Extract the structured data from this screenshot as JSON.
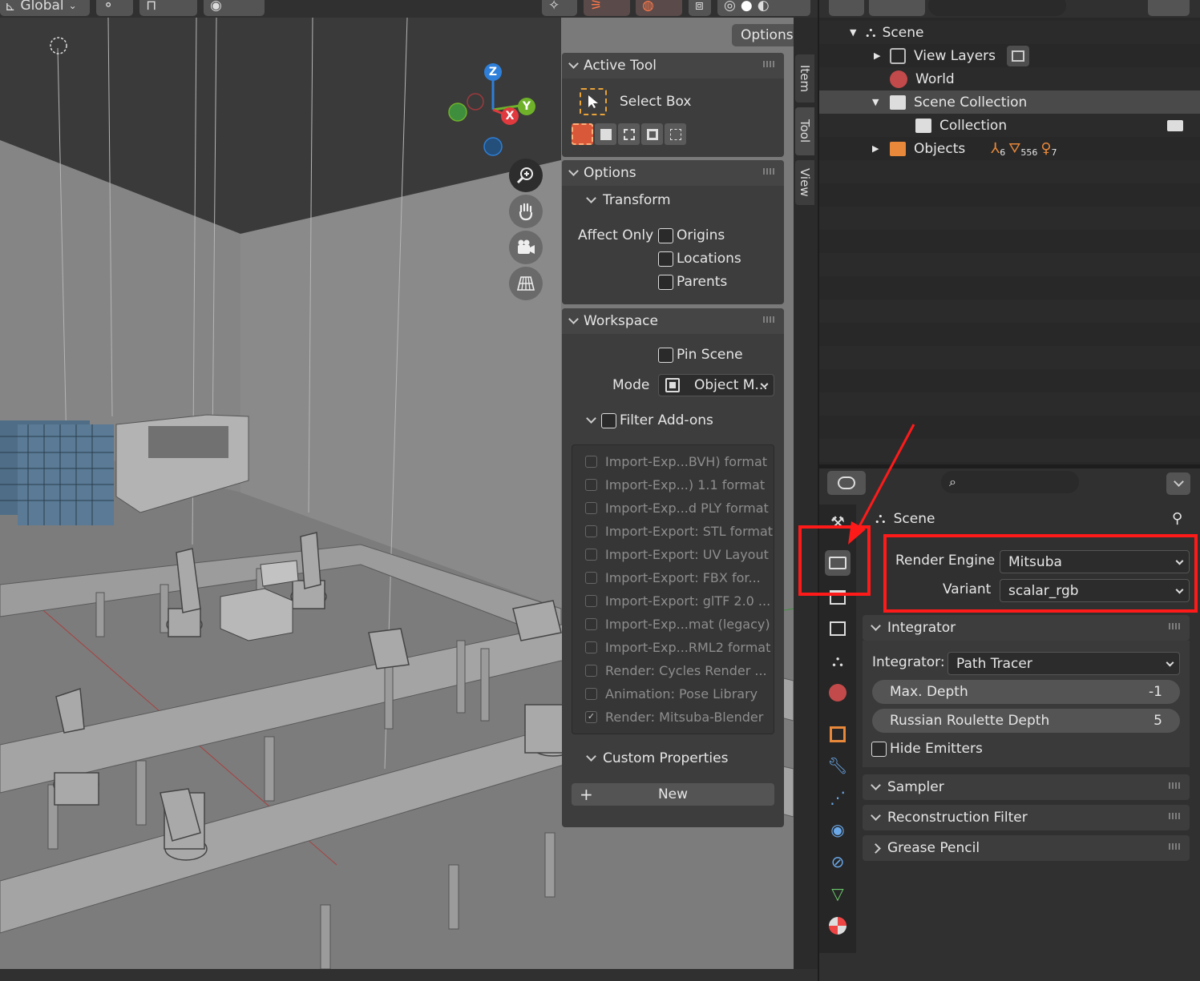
{
  "viewport_header": {
    "orientation": "Global",
    "options": "Options"
  },
  "sidebar_tabs": [
    "Item",
    "Tool",
    "View"
  ],
  "active_tool": {
    "title": "Active Tool",
    "tool_name": "Select Box"
  },
  "options_panel": {
    "title": "Options",
    "transform": "Transform",
    "affect_only": "Affect Only",
    "origins": "Origins",
    "locations": "Locations",
    "parents": "Parents"
  },
  "workspace": {
    "title": "Workspace",
    "pin_scene": "Pin Scene",
    "mode_label": "Mode",
    "mode_value": "Object M...",
    "filter_addons": "Filter Add-ons",
    "addons": [
      {
        "label": "Import-Exp...BVH) format",
        "checked": false
      },
      {
        "label": "Import-Exp...) 1.1 format",
        "checked": false
      },
      {
        "label": "Import-Exp...d PLY format",
        "checked": false
      },
      {
        "label": "Import-Export: STL format",
        "checked": false
      },
      {
        "label": "Import-Export: UV Layout",
        "checked": false
      },
      {
        "label": "Import-Export: FBX for...",
        "checked": false
      },
      {
        "label": "Import-Export: glTF 2.0 ...",
        "checked": false
      },
      {
        "label": "Import-Exp...mat (legacy)",
        "checked": false
      },
      {
        "label": "Import-Exp...RML2 format",
        "checked": false
      },
      {
        "label": "Render: Cycles Render ...",
        "checked": false
      },
      {
        "label": "Animation: Pose Library",
        "checked": false
      },
      {
        "label": "Render: Mitsuba-Blender",
        "checked": true
      }
    ],
    "custom_properties": "Custom Properties",
    "new_button": "New"
  },
  "gizmo": {
    "z": "Z",
    "y": "Y",
    "x": "X"
  },
  "outliner": {
    "rows": [
      {
        "label": "Scene"
      },
      {
        "label": "View Layers"
      },
      {
        "label": "World"
      },
      {
        "label": "Scene Collection"
      },
      {
        "label": "Collection"
      },
      {
        "label": "Objects"
      }
    ],
    "objects_counts": {
      "a": "6",
      "b": "556",
      "c": "7"
    }
  },
  "properties": {
    "context": "Scene",
    "render_engine_label": "Render Engine",
    "render_engine_value": "Mitsuba",
    "variant_label": "Variant",
    "variant_value": "scalar_rgb",
    "integrator_section": "Integrator",
    "integrator_label": "Integrator:",
    "integrator_value": "Path Tracer",
    "max_depth_label": "Max. Depth",
    "max_depth_value": "-1",
    "rr_depth_label": "Russian Roulette Depth",
    "rr_depth_value": "5",
    "hide_emitters": "Hide Emitters",
    "sampler": "Sampler",
    "reconstruction_filter": "Reconstruction Filter",
    "grease_pencil": "Grease Pencil"
  },
  "colors": {
    "accent_red": "#ff1a1a",
    "gizmo_z": "#2e7fd9",
    "gizmo_y": "#6fb22a",
    "gizmo_x": "#e0393e"
  }
}
